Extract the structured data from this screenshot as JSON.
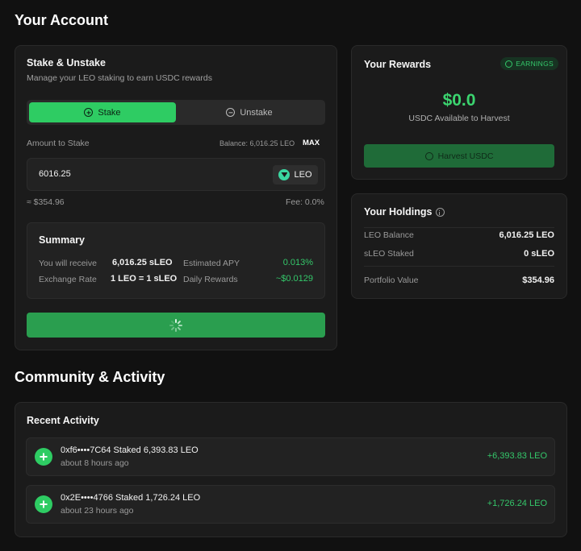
{
  "page_title": "Your Account",
  "stake": {
    "title": "Stake & Unstake",
    "subtitle": "Manage your LEO staking to earn USDC rewards",
    "tab_stake": "Stake",
    "tab_unstake": "Unstake",
    "amount_label": "Amount to Stake",
    "balance_text": "Balance: 6,016.25 LEO",
    "max_label": "MAX",
    "amount_value": "6016.25",
    "token": "LEO",
    "usd_equiv": "≈ $354.96",
    "fee": "Fee: 0.0%",
    "summary": {
      "title": "Summary",
      "receive_label": "You will receive",
      "receive_value": "6,016.25 sLEO",
      "apy_label": "Estimated APY",
      "apy_value": "0.013%",
      "rate_label": "Exchange Rate",
      "rate_value": "1 LEO = 1 sLEO",
      "daily_label": "Daily Rewards",
      "daily_value": "~$0.0129"
    }
  },
  "rewards": {
    "title": "Your Rewards",
    "badge": "EARNINGS",
    "amount": "$0.0",
    "caption": "USDC Available to Harvest",
    "harvest_label": "Harvest USDC"
  },
  "holdings": {
    "title": "Your Holdings",
    "rows": [
      {
        "label": "LEO Balance",
        "value": "6,016.25 LEO"
      },
      {
        "label": "sLEO Staked",
        "value": "0 sLEO"
      },
      {
        "label": "Portfolio Value",
        "value": "$354.96"
      }
    ]
  },
  "community": {
    "title": "Community & Activity",
    "recent_title": "Recent Activity",
    "items": [
      {
        "text": "0xf6••••7C64 Staked 6,393.83 LEO",
        "time": "about 8 hours ago",
        "amount": "+6,393.83 LEO"
      },
      {
        "text": "0x2E••••4766 Staked 1,726.24 LEO",
        "time": "about 23 hours ago",
        "amount": "+1,726.24 LEO"
      }
    ]
  },
  "colors": {
    "accent": "#2ecc63",
    "background": "#111111",
    "card": "#1b1b1b"
  }
}
